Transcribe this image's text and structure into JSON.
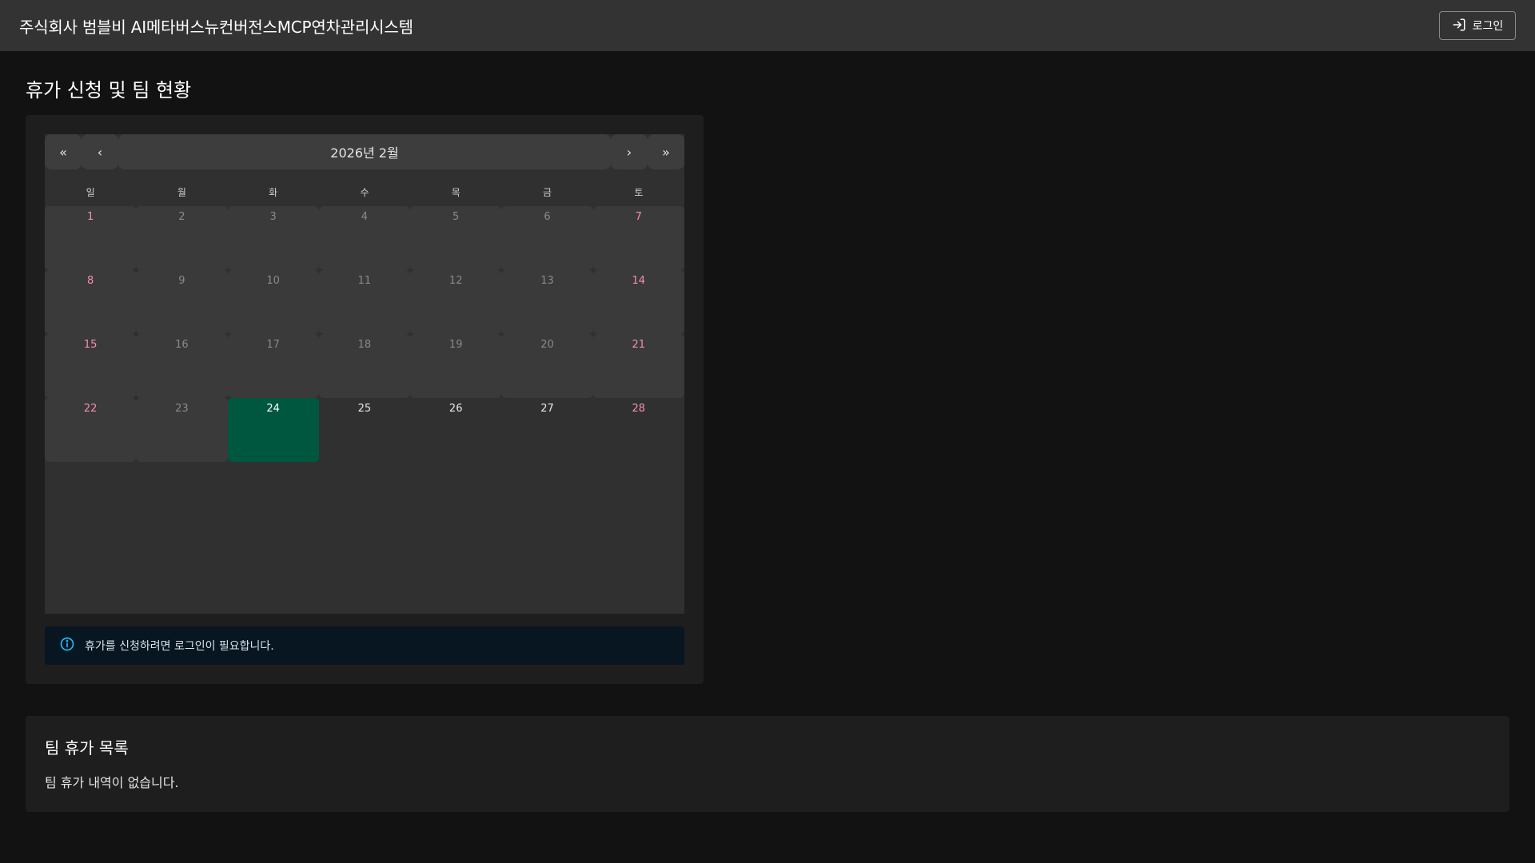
{
  "header": {
    "title": "주식회사 범블비 AI메타버스뉴컨버전스MCP연차관리시스템",
    "login_label": "로그인"
  },
  "page": {
    "title": "휴가 신청 및 팀 현황"
  },
  "calendar": {
    "nav": {
      "prev_year": "«",
      "prev_month": "‹",
      "label": "2026년 2월",
      "next_month": "›",
      "next_year": "»"
    },
    "weekdays": [
      "일",
      "월",
      "화",
      "수",
      "목",
      "금",
      "토"
    ],
    "days": [
      {
        "label": "1",
        "weekend": true,
        "state": "past"
      },
      {
        "label": "2",
        "weekend": false,
        "state": "past"
      },
      {
        "label": "3",
        "weekend": false,
        "state": "past"
      },
      {
        "label": "4",
        "weekend": false,
        "state": "past"
      },
      {
        "label": "5",
        "weekend": false,
        "state": "past"
      },
      {
        "label": "6",
        "weekend": false,
        "state": "past"
      },
      {
        "label": "7",
        "weekend": true,
        "state": "past"
      },
      {
        "label": "8",
        "weekend": true,
        "state": "past"
      },
      {
        "label": "9",
        "weekend": false,
        "state": "past"
      },
      {
        "label": "10",
        "weekend": false,
        "state": "past"
      },
      {
        "label": "11",
        "weekend": false,
        "state": "past"
      },
      {
        "label": "12",
        "weekend": false,
        "state": "past"
      },
      {
        "label": "13",
        "weekend": false,
        "state": "past"
      },
      {
        "label": "14",
        "weekend": true,
        "state": "past"
      },
      {
        "label": "15",
        "weekend": true,
        "state": "past"
      },
      {
        "label": "16",
        "weekend": false,
        "state": "past"
      },
      {
        "label": "17",
        "weekend": false,
        "state": "past"
      },
      {
        "label": "18",
        "weekend": false,
        "state": "past"
      },
      {
        "label": "19",
        "weekend": false,
        "state": "past"
      },
      {
        "label": "20",
        "weekend": false,
        "state": "past"
      },
      {
        "label": "21",
        "weekend": true,
        "state": "past"
      },
      {
        "label": "22",
        "weekend": true,
        "state": "past"
      },
      {
        "label": "23",
        "weekend": false,
        "state": "past"
      },
      {
        "label": "24",
        "weekend": false,
        "state": "today"
      },
      {
        "label": "25",
        "weekend": false,
        "state": "future"
      },
      {
        "label": "26",
        "weekend": false,
        "state": "future"
      },
      {
        "label": "27",
        "weekend": false,
        "state": "future"
      },
      {
        "label": "28",
        "weekend": true,
        "state": "future"
      }
    ],
    "colors": {
      "today": "#00573f",
      "weekend": "#f48fb1"
    }
  },
  "alert": {
    "icon": "info-icon",
    "text": "휴가를 신청하려면 로그인이 필요합니다."
  },
  "team": {
    "title": "팀 휴가 목록",
    "empty_text": "팀 휴가 내역이 없습니다."
  }
}
